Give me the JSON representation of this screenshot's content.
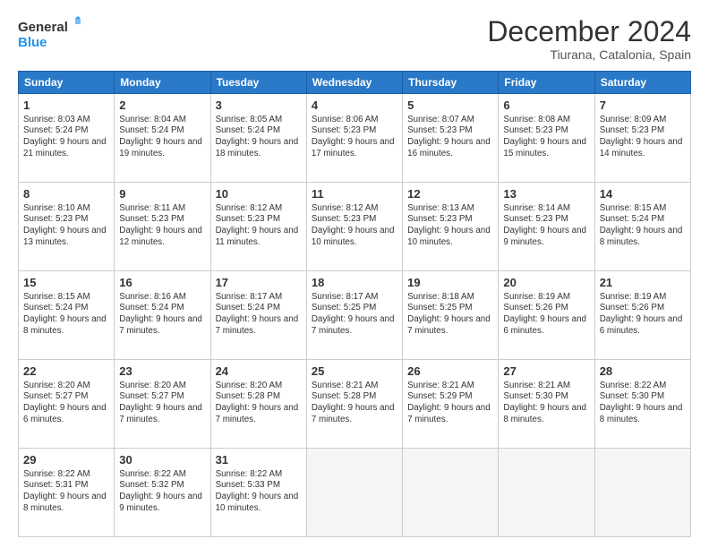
{
  "header": {
    "logo_line1": "General",
    "logo_line2": "Blue",
    "title": "December 2024",
    "subtitle": "Tiurana, Catalonia, Spain"
  },
  "calendar": {
    "days_of_week": [
      "Sunday",
      "Monday",
      "Tuesday",
      "Wednesday",
      "Thursday",
      "Friday",
      "Saturday"
    ],
    "weeks": [
      [
        {
          "day": "1",
          "sunrise": "8:03 AM",
          "sunset": "5:24 PM",
          "daylight": "9 hours and 21 minutes."
        },
        {
          "day": "2",
          "sunrise": "8:04 AM",
          "sunset": "5:24 PM",
          "daylight": "9 hours and 19 minutes."
        },
        {
          "day": "3",
          "sunrise": "8:05 AM",
          "sunset": "5:24 PM",
          "daylight": "9 hours and 18 minutes."
        },
        {
          "day": "4",
          "sunrise": "8:06 AM",
          "sunset": "5:23 PM",
          "daylight": "9 hours and 17 minutes."
        },
        {
          "day": "5",
          "sunrise": "8:07 AM",
          "sunset": "5:23 PM",
          "daylight": "9 hours and 16 minutes."
        },
        {
          "day": "6",
          "sunrise": "8:08 AM",
          "sunset": "5:23 PM",
          "daylight": "9 hours and 15 minutes."
        },
        {
          "day": "7",
          "sunrise": "8:09 AM",
          "sunset": "5:23 PM",
          "daylight": "9 hours and 14 minutes."
        }
      ],
      [
        {
          "day": "8",
          "sunrise": "8:10 AM",
          "sunset": "5:23 PM",
          "daylight": "9 hours and 13 minutes."
        },
        {
          "day": "9",
          "sunrise": "8:11 AM",
          "sunset": "5:23 PM",
          "daylight": "9 hours and 12 minutes."
        },
        {
          "day": "10",
          "sunrise": "8:12 AM",
          "sunset": "5:23 PM",
          "daylight": "9 hours and 11 minutes."
        },
        {
          "day": "11",
          "sunrise": "8:12 AM",
          "sunset": "5:23 PM",
          "daylight": "9 hours and 10 minutes."
        },
        {
          "day": "12",
          "sunrise": "8:13 AM",
          "sunset": "5:23 PM",
          "daylight": "9 hours and 10 minutes."
        },
        {
          "day": "13",
          "sunrise": "8:14 AM",
          "sunset": "5:23 PM",
          "daylight": "9 hours and 9 minutes."
        },
        {
          "day": "14",
          "sunrise": "8:15 AM",
          "sunset": "5:24 PM",
          "daylight": "9 hours and 8 minutes."
        }
      ],
      [
        {
          "day": "15",
          "sunrise": "8:15 AM",
          "sunset": "5:24 PM",
          "daylight": "9 hours and 8 minutes."
        },
        {
          "day": "16",
          "sunrise": "8:16 AM",
          "sunset": "5:24 PM",
          "daylight": "9 hours and 7 minutes."
        },
        {
          "day": "17",
          "sunrise": "8:17 AM",
          "sunset": "5:24 PM",
          "daylight": "9 hours and 7 minutes."
        },
        {
          "day": "18",
          "sunrise": "8:17 AM",
          "sunset": "5:25 PM",
          "daylight": "9 hours and 7 minutes."
        },
        {
          "day": "19",
          "sunrise": "8:18 AM",
          "sunset": "5:25 PM",
          "daylight": "9 hours and 7 minutes."
        },
        {
          "day": "20",
          "sunrise": "8:19 AM",
          "sunset": "5:26 PM",
          "daylight": "9 hours and 6 minutes."
        },
        {
          "day": "21",
          "sunrise": "8:19 AM",
          "sunset": "5:26 PM",
          "daylight": "9 hours and 6 minutes."
        }
      ],
      [
        {
          "day": "22",
          "sunrise": "8:20 AM",
          "sunset": "5:27 PM",
          "daylight": "9 hours and 6 minutes."
        },
        {
          "day": "23",
          "sunrise": "8:20 AM",
          "sunset": "5:27 PM",
          "daylight": "9 hours and 7 minutes."
        },
        {
          "day": "24",
          "sunrise": "8:20 AM",
          "sunset": "5:28 PM",
          "daylight": "9 hours and 7 minutes."
        },
        {
          "day": "25",
          "sunrise": "8:21 AM",
          "sunset": "5:28 PM",
          "daylight": "9 hours and 7 minutes."
        },
        {
          "day": "26",
          "sunrise": "8:21 AM",
          "sunset": "5:29 PM",
          "daylight": "9 hours and 7 minutes."
        },
        {
          "day": "27",
          "sunrise": "8:21 AM",
          "sunset": "5:30 PM",
          "daylight": "9 hours and 8 minutes."
        },
        {
          "day": "28",
          "sunrise": "8:22 AM",
          "sunset": "5:30 PM",
          "daylight": "9 hours and 8 minutes."
        }
      ],
      [
        {
          "day": "29",
          "sunrise": "8:22 AM",
          "sunset": "5:31 PM",
          "daylight": "9 hours and 8 minutes."
        },
        {
          "day": "30",
          "sunrise": "8:22 AM",
          "sunset": "5:32 PM",
          "daylight": "9 hours and 9 minutes."
        },
        {
          "day": "31",
          "sunrise": "8:22 AM",
          "sunset": "5:33 PM",
          "daylight": "9 hours and 10 minutes."
        },
        null,
        null,
        null,
        null
      ]
    ]
  },
  "labels": {
    "sunrise": "Sunrise:",
    "sunset": "Sunset:",
    "daylight": "Daylight:"
  }
}
